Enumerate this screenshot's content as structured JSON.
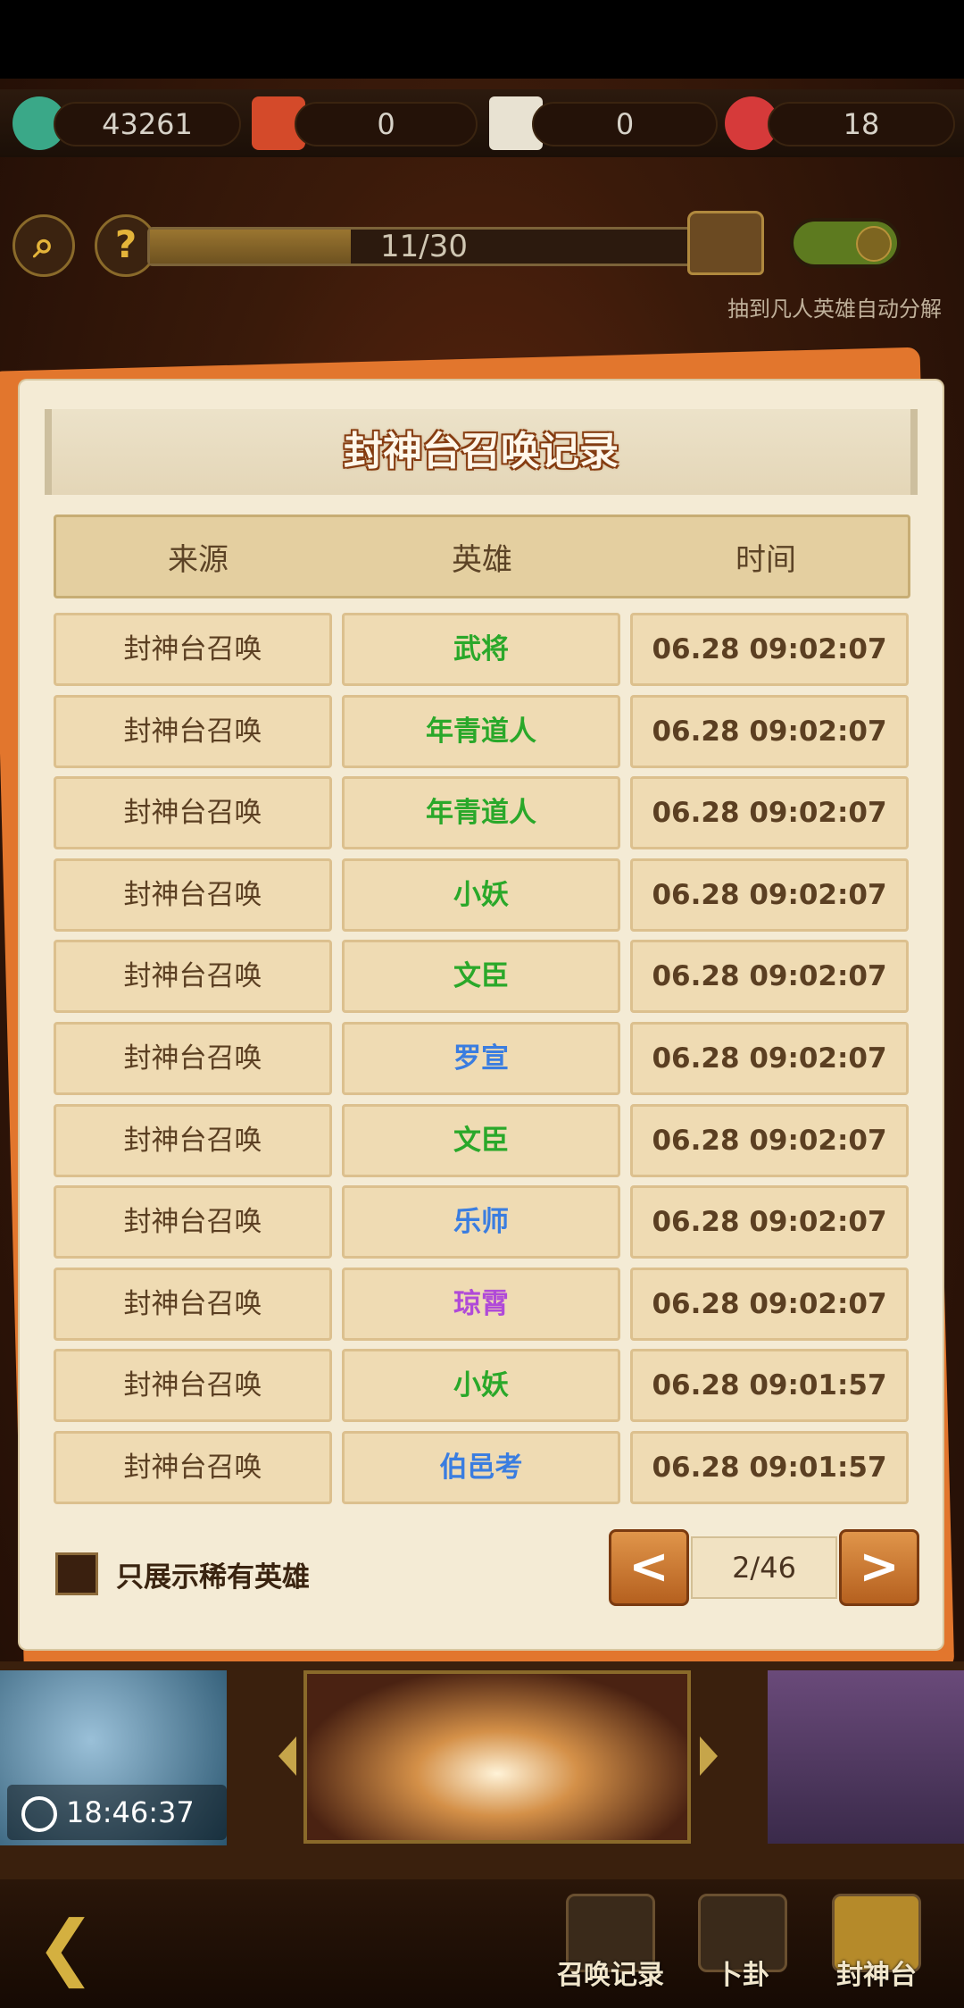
{
  "currencies": [
    {
      "name": "jade-coin",
      "value": "43261",
      "color": "#3aa888"
    },
    {
      "name": "red-envelope",
      "value": "0",
      "color": "#d44a2a"
    },
    {
      "name": "scroll-ticket",
      "value": "0",
      "color": "#e8e2d2"
    },
    {
      "name": "heart",
      "value": "18",
      "color": "#d63a3a"
    }
  ],
  "progress": {
    "text": "11/30",
    "fraction": 0.3667
  },
  "auto_decompose_text": "抽到凡人英雄自动分解",
  "modal": {
    "title": "封神台召唤记录",
    "headers": [
      "来源",
      "英雄",
      "时间"
    ],
    "rows": [
      {
        "source": "封神台召唤",
        "hero": "武将",
        "hero_color": "#2aa82a",
        "time": "06.28 09:02:07"
      },
      {
        "source": "封神台召唤",
        "hero": "年青道人",
        "hero_color": "#2aa82a",
        "time": "06.28 09:02:07"
      },
      {
        "source": "封神台召唤",
        "hero": "年青道人",
        "hero_color": "#2aa82a",
        "time": "06.28 09:02:07"
      },
      {
        "source": "封神台召唤",
        "hero": "小妖",
        "hero_color": "#2aa82a",
        "time": "06.28 09:02:07"
      },
      {
        "source": "封神台召唤",
        "hero": "文臣",
        "hero_color": "#2aa82a",
        "time": "06.28 09:02:07"
      },
      {
        "source": "封神台召唤",
        "hero": "罗宣",
        "hero_color": "#3a7de0",
        "time": "06.28 09:02:07"
      },
      {
        "source": "封神台召唤",
        "hero": "文臣",
        "hero_color": "#2aa82a",
        "time": "06.28 09:02:07"
      },
      {
        "source": "封神台召唤",
        "hero": "乐师",
        "hero_color": "#3a7de0",
        "time": "06.28 09:02:07"
      },
      {
        "source": "封神台召唤",
        "hero": "琼霄",
        "hero_color": "#b04ad8",
        "time": "06.28 09:02:07"
      },
      {
        "source": "封神台召唤",
        "hero": "小妖",
        "hero_color": "#2aa82a",
        "time": "06.28 09:01:57"
      },
      {
        "source": "封神台召唤",
        "hero": "伯邑考",
        "hero_color": "#3a7de0",
        "time": "06.28 09:01:57"
      }
    ],
    "filter_label": "只展示稀有英雄",
    "filter_checked": false,
    "pager": {
      "prev": "<",
      "next": ">",
      "text": "2/46"
    }
  },
  "timer": "18:46:37",
  "bottom_nav": [
    {
      "label": "召唤记录",
      "icon": "record-scroll-icon"
    },
    {
      "label": "卜卦",
      "icon": "yin-yang-icon"
    },
    {
      "label": "封神台",
      "icon": "altar-icon"
    }
  ],
  "colors": {
    "accent_orange": "#e2762d",
    "parchment": "#f4ebd5",
    "cell": "#efdbb3"
  }
}
